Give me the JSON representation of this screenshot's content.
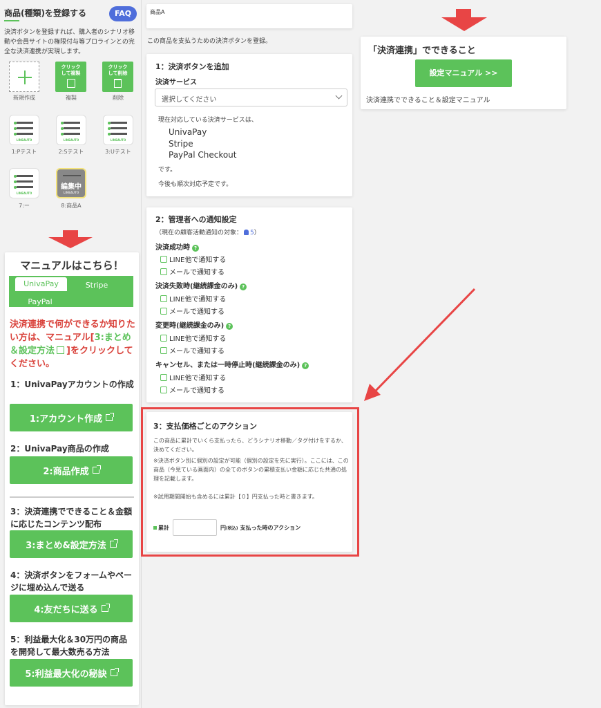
{
  "left": {
    "title": "商品(種類)を登録する",
    "faq": "FAQ",
    "desc": "決済ボタンを登録すれば、購入者のシナリオ移動や会員サイトの権限付与等プロラインとの完全な決済連携が実現します。",
    "new_label": "新規作成",
    "copy_btn": "クリックして複製",
    "copy_label": "複製",
    "del_btn": "クリックして削除",
    "del_label": "削除",
    "brand": "LINEAUTO",
    "items": [
      {
        "label": "1:Pテスト"
      },
      {
        "label": "2:Sテスト"
      },
      {
        "label": "3:Uテスト"
      },
      {
        "label": "7:ー"
      },
      {
        "label": "8:商品A"
      }
    ],
    "editing": "編集中"
  },
  "manual": {
    "title": "マニュアルはこちら！",
    "tabs": [
      "UnivaPay",
      "Stripe",
      "PayPal"
    ],
    "notice_a": "決済連携で何ができるか知りたい方は、マニュアル[",
    "notice_link": "3:まとめ＆設定方法",
    "notice_b": "]をクリックしてください。",
    "steps": [
      {
        "heading": "1：UnivaPayアカウントの作成",
        "button": "1:アカウント作成"
      },
      {
        "heading": "2：UnivaPay商品の作成",
        "button": "2:商品作成"
      },
      {
        "heading": "3：決済連携でできること＆金額に応じたコンテンツ配布",
        "button": "3:まとめ&設定方法"
      },
      {
        "heading": "4：決済ボタンをフォームやページに埋め込んで送る",
        "button": "4:友だちに送る"
      },
      {
        "heading": "5：利益最大化＆30万円の商品を開発して最大数売る方法",
        "button": "5:利益最大化の秘訣"
      }
    ]
  },
  "product": {
    "name": "商品A",
    "sub": "この商品を支払うための決済ボタンを登録。"
  },
  "section1": {
    "title": "1：決済ボタンを追加",
    "service_label": "決済サービス",
    "select_placeholder": "選択してください",
    "supported_intro": "現在対応している決済サービスは、",
    "services": [
      "UnivaPay",
      "Stripe",
      "PayPal Checkout"
    ],
    "desu": "です。",
    "future": "今後も順次対応予定です。"
  },
  "section2": {
    "title": "2：管理者への通知設定",
    "target_prefix": "（現在の顧客活動通知の対象：",
    "target_count": "5",
    "target_suffix": "）",
    "groups": [
      {
        "label": "決済成功時",
        "opts": [
          "LINE他で通知する",
          "メールで通知する"
        ]
      },
      {
        "label": "決済失敗時(継続課金のみ)",
        "opts": [
          "LINE他で通知する",
          "メールで通知する"
        ]
      },
      {
        "label": "変更時(継続課金のみ)",
        "opts": [
          "LINE他で通知する",
          "メールで通知する"
        ]
      },
      {
        "label": "キャンセル、または一時停止時(継続課金のみ)",
        "opts": [
          "LINE他で通知する",
          "メールで通知する"
        ]
      }
    ]
  },
  "section3": {
    "title": "3：支払価格ごとのアクション",
    "p1": "この商品に累計でいくら支払ったら、どうシナリオ移動／タグ付けをするか、決めてください。",
    "p2": "※決済ボタン別に個別の設定が可能（個別の設定を先に実行）。ここには、この商品（今見ている画面内）の全てのボタンの累積支払い金額に応じた共通の処理を記載します。",
    "p3": "※試用期間開始も含めるには累計【０】円支払った時と書きます。",
    "cum_label": "累計",
    "yen": "円",
    "tax": "(税込)",
    "after": "支払った時のアクション"
  },
  "right": {
    "title": "「決済連携」でできること",
    "button": "設定マニュアル >>",
    "caption": "決済連携でできること＆設定マニュアル"
  },
  "colors": {
    "green": "#5cc25a",
    "red": "#e84545",
    "faq": "#4f6edb",
    "notice_red": "#d9413a"
  }
}
